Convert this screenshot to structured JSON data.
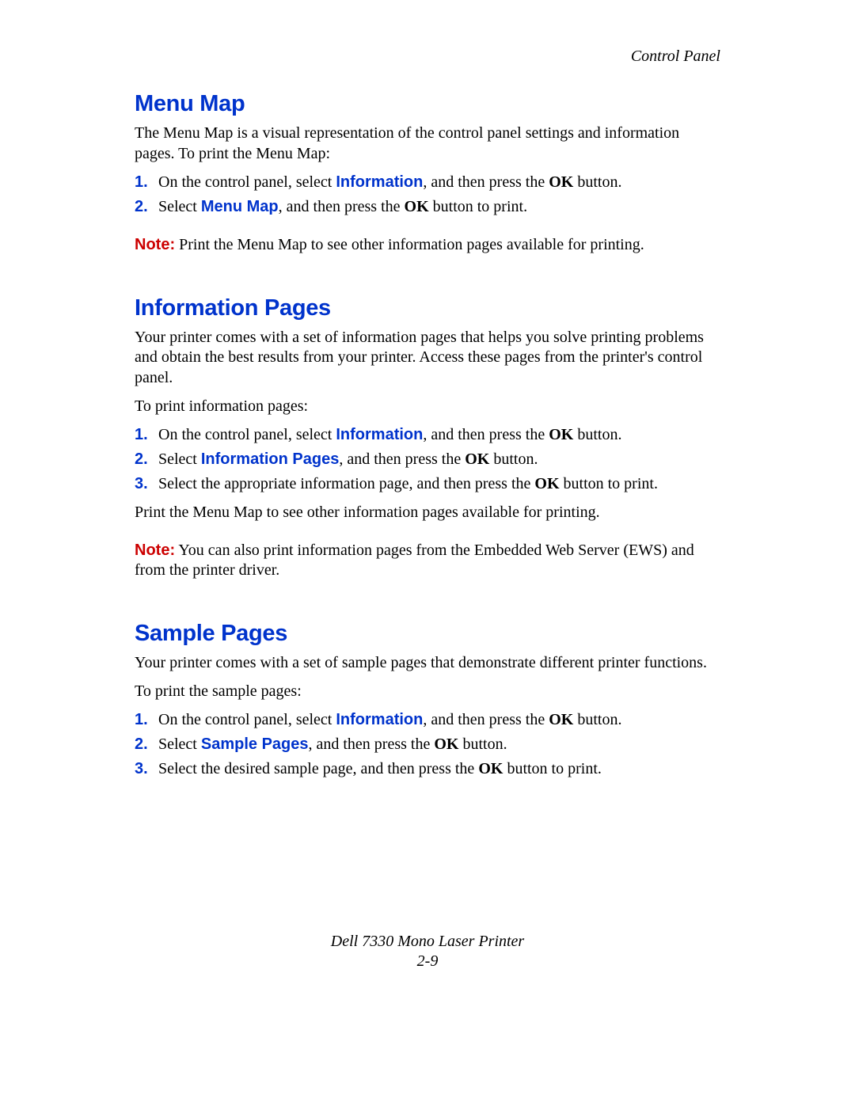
{
  "runningHead": "Control Panel",
  "footer": {
    "line1": "Dell 7330 Mono Laser Printer",
    "line2": "2-9"
  },
  "labels": {
    "note": "Note:",
    "ok": "OK"
  },
  "menuItems": {
    "information": "Information",
    "menuMap": "Menu Map",
    "informationPages": "Information Pages",
    "samplePages": "Sample Pages"
  },
  "sections": {
    "menuMap": {
      "heading": "Menu Map",
      "intro": "The Menu Map is a visual representation of the control panel settings and information pages. To print the Menu Map:",
      "steps": [
        {
          "num": "1.",
          "pre": "On the control panel, select ",
          "link": "information",
          "post1": ", and then press the ",
          "post2": " button."
        },
        {
          "num": "2.",
          "pre": "Select ",
          "link": "menuMap",
          "post1": ", and then press the ",
          "post2": " button to print."
        }
      ],
      "noteText": " Print the Menu Map to see other information pages available for printing."
    },
    "infoPages": {
      "heading": "Information Pages",
      "intro": "Your printer comes with a set of information pages that helps you solve printing problems and obtain the best results from your printer. Access these pages from the printer's control panel.",
      "lead": "To print information pages:",
      "steps": [
        {
          "num": "1.",
          "pre": "On the control panel, select ",
          "link": "information",
          "post1": ", and then press the ",
          "post2": " button."
        },
        {
          "num": "2.",
          "pre": "Select ",
          "link": "informationPages",
          "post1": ", and then press the ",
          "post2": " button."
        },
        {
          "num": "3.",
          "text1": "Select the appropriate information page, and then press the ",
          "text2": " button to print."
        }
      ],
      "after": "Print the Menu Map to see other information pages available for printing.",
      "noteText": " You can also print information pages from the Embedded Web Server (EWS) and from the printer driver."
    },
    "samplePages": {
      "heading": "Sample Pages",
      "intro": "Your printer comes with a set of sample pages that demonstrate different printer functions.",
      "lead": "To print the sample pages:",
      "steps": [
        {
          "num": "1.",
          "pre": "On the control panel, select ",
          "link": "information",
          "post1": ", and then press the ",
          "post2": " button."
        },
        {
          "num": "2.",
          "pre": "Select ",
          "link": "samplePages",
          "post1": ", and then press the ",
          "post2": " button."
        },
        {
          "num": "3.",
          "text1": "Select the desired sample page, and then press the ",
          "text2": " button to print."
        }
      ]
    }
  }
}
